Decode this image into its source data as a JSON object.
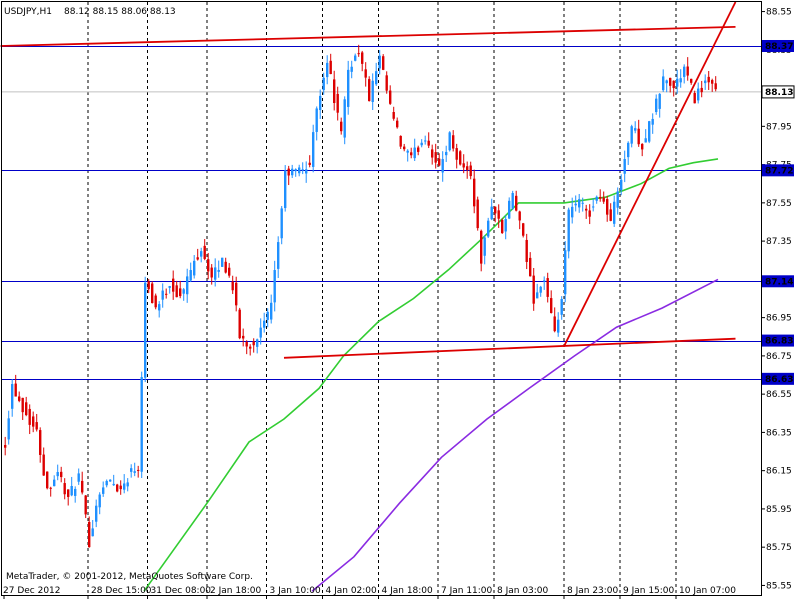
{
  "chart_data": {
    "type": "candlestick",
    "symbol_header": "USDJPY,H1",
    "ohlc_header": "88.12 88.15 88.06 88.13",
    "watermark": "MetaTrader, © 2001-2012, MetaQuotes Software Corp.",
    "ylim": [
      85.5,
      88.6
    ],
    "y_ticks": [
      88.55,
      88.35,
      88.13,
      87.95,
      87.75,
      87.55,
      87.35,
      87.15,
      86.95,
      86.75,
      86.55,
      86.35,
      86.15,
      85.95,
      85.75,
      85.55
    ],
    "x_labels": [
      {
        "label": "27 Dec 2012",
        "bar": 0
      },
      {
        "label": "28 Dec 15:00",
        "bar": 24
      },
      {
        "label": "31 Dec 08:00",
        "bar": 41
      },
      {
        "label": "2 Jan 18:00",
        "bar": 58
      },
      {
        "label": "3 Jan 10:00",
        "bar": 75
      },
      {
        "label": "4 Jan 02:00",
        "bar": 91
      },
      {
        "label": "4 Jan 18:00",
        "bar": 107
      },
      {
        "label": "7 Jan 11:00",
        "bar": 124
      },
      {
        "label": "8 Jan 03:00",
        "bar": 140
      },
      {
        "label": "8 Jan 23:00",
        "bar": 160
      },
      {
        "label": "9 Jan 15:00",
        "bar": 176
      },
      {
        "label": "10 Jan 07:00",
        "bar": 192
      }
    ],
    "bar_count": 204,
    "anchors": [
      [
        0,
        86.3
      ],
      [
        2,
        86.6
      ],
      [
        5,
        86.48
      ],
      [
        9,
        86.35
      ],
      [
        12,
        86.05
      ],
      [
        15,
        86.15
      ],
      [
        18,
        86.0
      ],
      [
        21,
        86.12
      ],
      [
        24,
        85.78
      ],
      [
        27,
        86.05
      ],
      [
        30,
        86.1
      ],
      [
        33,
        86.05
      ],
      [
        36,
        86.15
      ],
      [
        38,
        86.17
      ],
      [
        40,
        87.15
      ],
      [
        43,
        87.0
      ],
      [
        47,
        87.13
      ],
      [
        50,
        87.05
      ],
      [
        53,
        87.2
      ],
      [
        56,
        87.32
      ],
      [
        59,
        87.15
      ],
      [
        62,
        87.25
      ],
      [
        65,
        87.12
      ],
      [
        67,
        86.85
      ],
      [
        70,
        86.8
      ],
      [
        73,
        86.88
      ],
      [
        76,
        87.0
      ],
      [
        78,
        87.35
      ],
      [
        80,
        87.7
      ],
      [
        84,
        87.72
      ],
      [
        87,
        87.75
      ],
      [
        89,
        88.05
      ],
      [
        92,
        88.3
      ],
      [
        94,
        88.1
      ],
      [
        96,
        87.9
      ],
      [
        98,
        88.25
      ],
      [
        101,
        88.35
      ],
      [
        104,
        88.1
      ],
      [
        107,
        88.3
      ],
      [
        110,
        88.05
      ],
      [
        113,
        87.85
      ],
      [
        116,
        87.78
      ],
      [
        120,
        87.9
      ],
      [
        124,
        87.72
      ],
      [
        127,
        87.9
      ],
      [
        130,
        87.75
      ],
      [
        133,
        87.7
      ],
      [
        136,
        87.25
      ],
      [
        139,
        87.55
      ],
      [
        142,
        87.4
      ],
      [
        145,
        87.6
      ],
      [
        148,
        87.35
      ],
      [
        151,
        87.05
      ],
      [
        154,
        87.15
      ],
      [
        157,
        86.85
      ],
      [
        159,
        87.05
      ],
      [
        161,
        87.5
      ],
      [
        164,
        87.55
      ],
      [
        167,
        87.5
      ],
      [
        170,
        87.6
      ],
      [
        173,
        87.45
      ],
      [
        176,
        87.7
      ],
      [
        179,
        87.95
      ],
      [
        182,
        87.85
      ],
      [
        185,
        88.0
      ],
      [
        188,
        88.2
      ],
      [
        191,
        88.15
      ],
      [
        194,
        88.25
      ],
      [
        197,
        88.1
      ],
      [
        200,
        88.18
      ],
      [
        203,
        88.13
      ]
    ],
    "series": [
      {
        "kind": "ma",
        "color": "#32cd32",
        "points": [
          [
            40,
            85.52
          ],
          [
            58,
            85.98
          ],
          [
            70,
            86.3
          ],
          [
            80,
            86.42
          ],
          [
            90,
            86.58
          ],
          [
            97,
            86.75
          ],
          [
            107,
            86.93
          ],
          [
            117,
            87.05
          ],
          [
            127,
            87.2
          ],
          [
            137,
            87.37
          ],
          [
            147,
            87.55
          ],
          [
            160,
            87.55
          ],
          [
            172,
            87.58
          ],
          [
            182,
            87.65
          ],
          [
            190,
            87.73
          ],
          [
            197,
            87.76
          ],
          [
            204,
            87.78
          ]
        ]
      },
      {
        "kind": "ma",
        "color": "#8a2be2",
        "points": [
          [
            88,
            85.52
          ],
          [
            100,
            85.7
          ],
          [
            113,
            85.98
          ],
          [
            125,
            86.22
          ],
          [
            138,
            86.42
          ],
          [
            150,
            86.58
          ],
          [
            163,
            86.75
          ],
          [
            175,
            86.9
          ],
          [
            188,
            87.0
          ],
          [
            204,
            87.15
          ]
        ]
      }
    ],
    "trendlines": [
      {
        "color": "#dc0000",
        "from": [
          -1,
          88.37
        ],
        "to": [
          209,
          88.47
        ]
      },
      {
        "color": "#dc0000",
        "from": [
          80,
          86.74
        ],
        "to": [
          209,
          86.84
        ]
      },
      {
        "color": "#dc0000",
        "from": [
          160,
          86.8
        ],
        "to": [
          209,
          88.6
        ]
      }
    ],
    "hlines": [
      {
        "value": 88.37,
        "label": "88.37"
      },
      {
        "value": 87.72,
        "label": "87.72"
      },
      {
        "value": 87.14,
        "label": "87.14"
      },
      {
        "value": 86.83,
        "label": "86.83"
      },
      {
        "value": 86.63,
        "label": "86.63"
      }
    ],
    "last_price": {
      "value": 88.13,
      "label": "88.13"
    },
    "colors": {
      "up": "#1e90ff",
      "down": "#dc0000",
      "hline": "#0000c8",
      "tag_bg": "#0000c8",
      "grid": "#000000",
      "last_line": "#c0c0c0"
    }
  }
}
